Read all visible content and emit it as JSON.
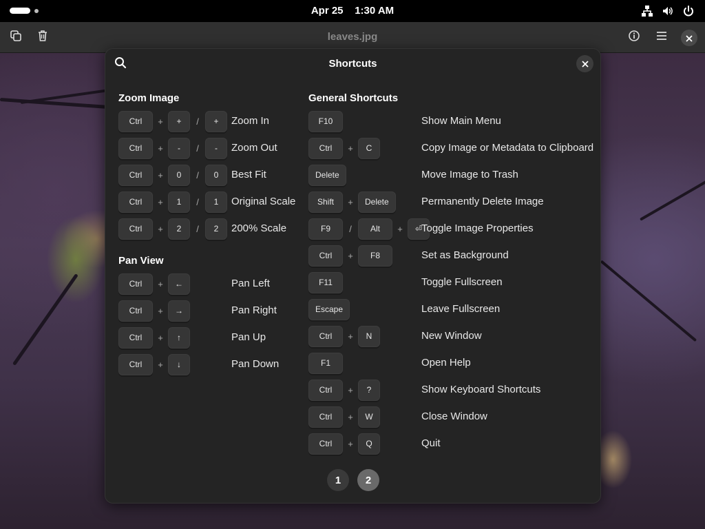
{
  "topbar": {
    "date": "Apr 25",
    "time": "1:30 AM",
    "icons": [
      "network-icon",
      "volume-icon",
      "power-icon"
    ]
  },
  "headerbar": {
    "title": "leaves.jpg",
    "icons": [
      "copy-icon",
      "trash-icon",
      "info-icon",
      "menu-icon",
      "close-icon"
    ]
  },
  "dialog": {
    "title": "Shortcuts",
    "zoom": {
      "title": "Zoom Image",
      "rows": [
        {
          "keys": [
            "Ctrl",
            "+",
            "+",
            "/",
            "+"
          ],
          "desc": "Zoom In"
        },
        {
          "keys": [
            "Ctrl",
            "+",
            "-",
            "/",
            "-"
          ],
          "desc": "Zoom Out"
        },
        {
          "keys": [
            "Ctrl",
            "+",
            "0",
            "/",
            "0"
          ],
          "desc": "Best Fit"
        },
        {
          "keys": [
            "Ctrl",
            "+",
            "1",
            "/",
            "1"
          ],
          "desc": "Original Scale"
        },
        {
          "keys": [
            "Ctrl",
            "+",
            "2",
            "/",
            "2"
          ],
          "desc": "200% Scale"
        }
      ]
    },
    "pan": {
      "title": "Pan View",
      "rows": [
        {
          "keys": [
            "Ctrl",
            "+",
            "←"
          ],
          "desc": "Pan Left"
        },
        {
          "keys": [
            "Ctrl",
            "+",
            "→"
          ],
          "desc": "Pan Right"
        },
        {
          "keys": [
            "Ctrl",
            "+",
            "↑"
          ],
          "desc": "Pan Up"
        },
        {
          "keys": [
            "Ctrl",
            "+",
            "↓"
          ],
          "desc": "Pan Down"
        }
      ]
    },
    "general": {
      "title": "General Shortcuts",
      "rows": [
        {
          "keys": [
            "F10"
          ],
          "desc": "Show Main Menu"
        },
        {
          "keys": [
            "Ctrl",
            "+",
            "C"
          ],
          "desc": "Copy Image or Metadata to Clipboard"
        },
        {
          "keys": [
            "Delete"
          ],
          "desc": "Move Image to Trash"
        },
        {
          "keys": [
            "Shift",
            "+",
            "Delete"
          ],
          "desc": "Permanently Delete Image"
        },
        {
          "keys": [
            "F9",
            "/",
            "Alt",
            "+",
            "⏎"
          ],
          "desc": "Toggle Image Properties"
        },
        {
          "keys": [
            "Ctrl",
            "+",
            "F8"
          ],
          "desc": "Set as Background"
        },
        {
          "keys": [
            "F11"
          ],
          "desc": "Toggle Fullscreen"
        },
        {
          "keys": [
            "Escape"
          ],
          "desc": "Leave Fullscreen"
        },
        {
          "keys": [
            "Ctrl",
            "+",
            "N"
          ],
          "desc": "New Window"
        },
        {
          "keys": [
            "F1"
          ],
          "desc": "Open Help"
        },
        {
          "keys": [
            "Ctrl",
            "+",
            "?"
          ],
          "desc": "Show Keyboard Shortcuts"
        },
        {
          "keys": [
            "Ctrl",
            "+",
            "W"
          ],
          "desc": "Close Window"
        },
        {
          "keys": [
            "Ctrl",
            "+",
            "Q"
          ],
          "desc": "Quit"
        }
      ]
    },
    "pages": [
      "1",
      "2"
    ],
    "active_page": "2"
  }
}
